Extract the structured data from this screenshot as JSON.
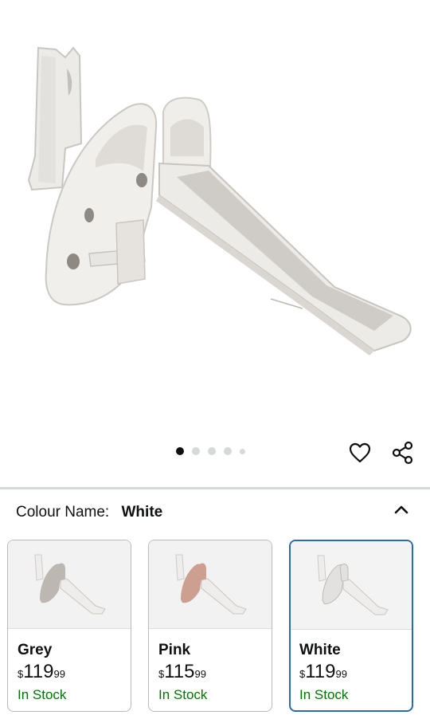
{
  "product": {
    "image_alt": "Children's slide product image",
    "gallery": {
      "total": 5,
      "active": 1
    },
    "actions": {
      "wishlist_icon": "heart-icon",
      "share_icon": "share-icon"
    }
  },
  "variation": {
    "label": "Colour Name:",
    "selected": "White",
    "toggle_icon": "chevron-up-icon",
    "options": [
      {
        "name": "Grey",
        "currency": "$",
        "whole": "119",
        "fraction": "99",
        "stock": "In Stock",
        "tint": "#bdb7b1"
      },
      {
        "name": "Pink",
        "currency": "$",
        "whole": "115",
        "fraction": "99",
        "stock": "In Stock",
        "tint": "#cc9f91"
      },
      {
        "name": "White",
        "currency": "$",
        "whole": "119",
        "fraction": "99",
        "stock": "In Stock",
        "tint": "#e3e1df"
      }
    ]
  },
  "colors": {
    "stock_green": "#007600",
    "selected_border": "#2e6aa7"
  }
}
